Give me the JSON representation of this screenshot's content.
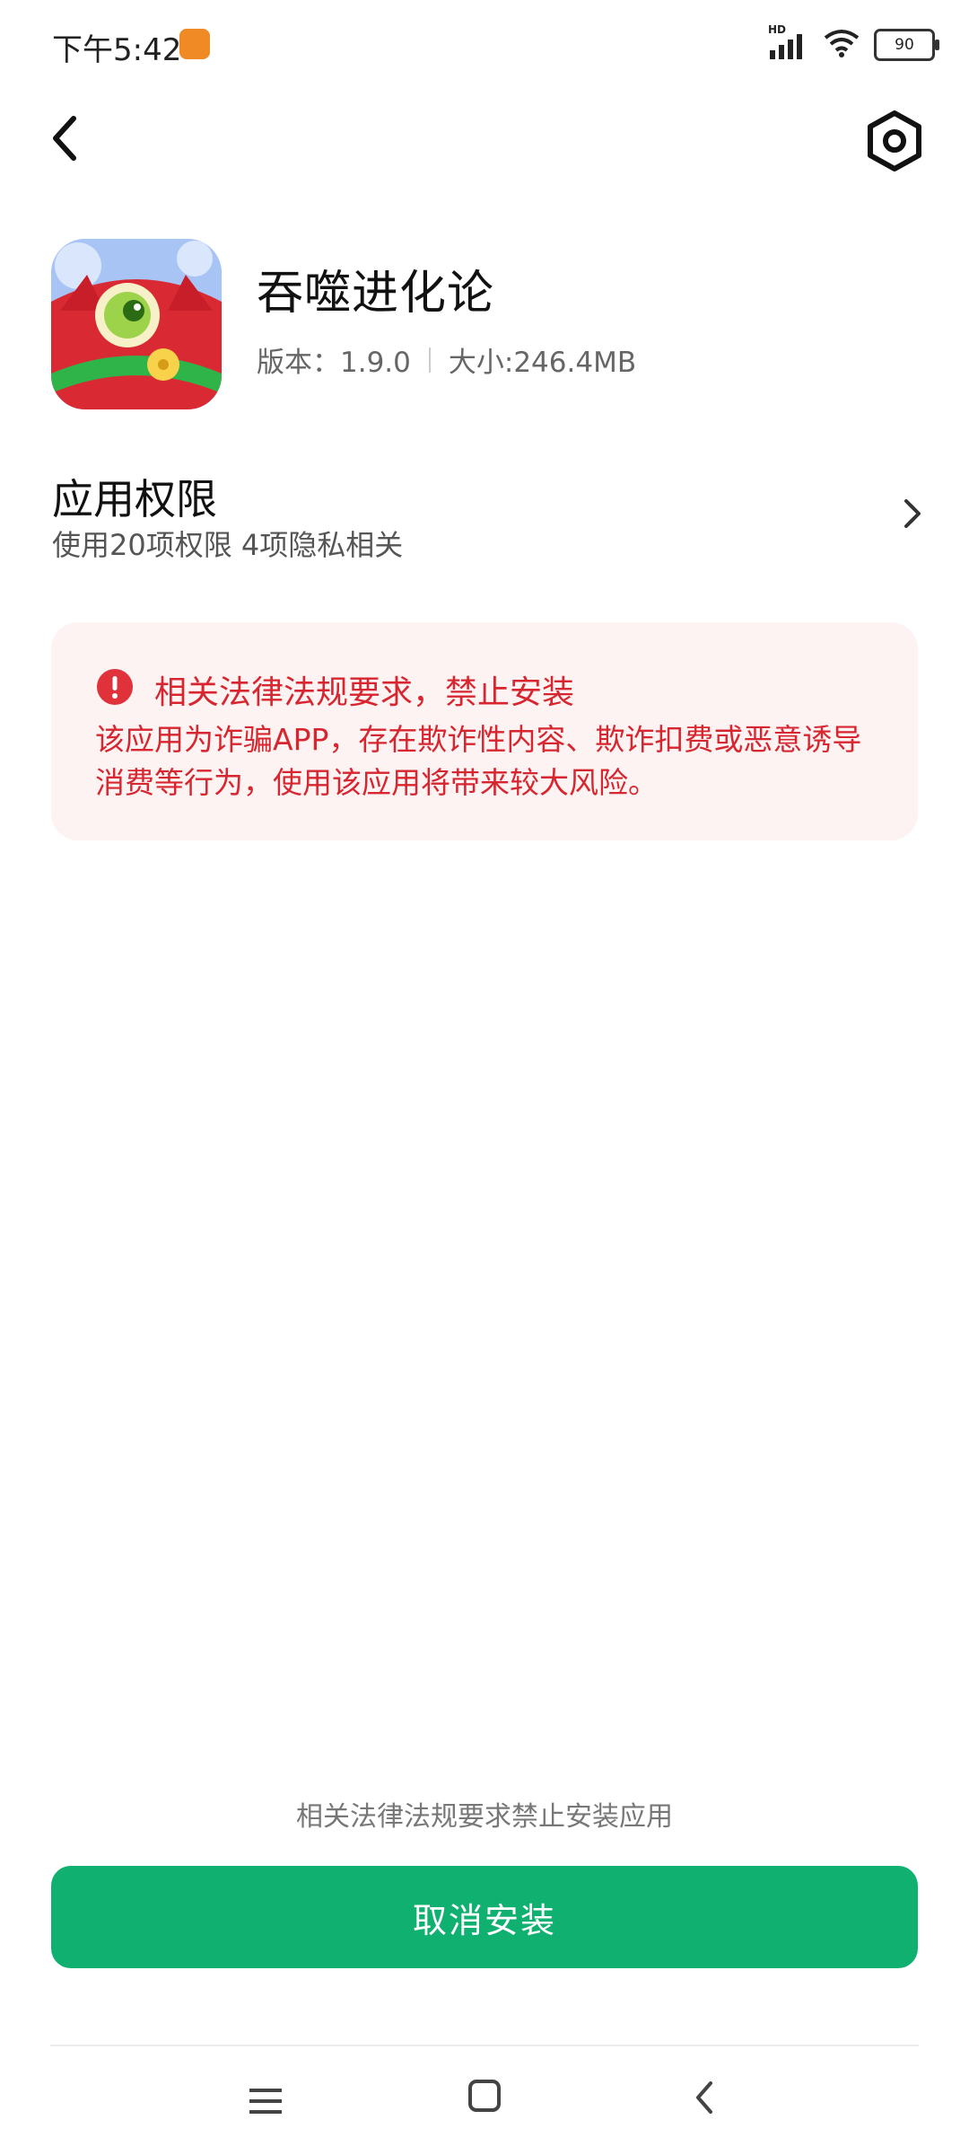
{
  "status_bar": {
    "time": "下午5:42",
    "network": "HD",
    "battery": "90"
  },
  "app": {
    "name": "吞噬进化论",
    "version": "版本：1.9.0",
    "size": "大小:246.4MB"
  },
  "permissions": {
    "title": "应用权限",
    "subtitle": "使用20项权限 4项隐私相关"
  },
  "warning": {
    "title": "相关法律法规要求，禁止安装",
    "body": "该应用为诈骗APP，存在欺诈性内容、欺诈扣费或恶意诱导消费等行为，使用该应用将带来较大风险。",
    "color": "#d7262f"
  },
  "footer": {
    "note": "相关法律法规要求禁止安装应用",
    "button": "取消安装",
    "button_color": "#10b070"
  },
  "icons": [
    "back-icon",
    "settings-icon",
    "chevron-right-icon",
    "alert-icon",
    "nav-menu-icon",
    "nav-home-icon",
    "nav-back-icon"
  ]
}
